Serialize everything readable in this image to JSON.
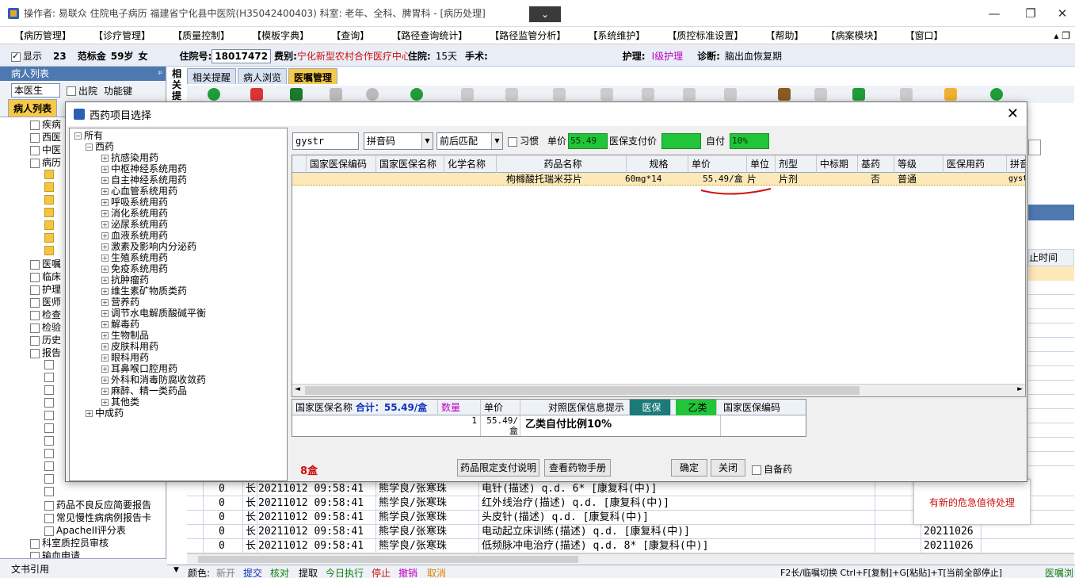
{
  "window": {
    "title": "操作者: 易联众 住院电子病历 福建省宁化县中医院(H35042400403) 科室: 老年、全科、脾胃科 - [病历处理]",
    "dropdown_glyph": "⌄",
    "min_glyph": "—",
    "restore_glyph": "❐",
    "close_glyph": "✕"
  },
  "menu": {
    "items": [
      "病历管理",
      "诊疗管理",
      "质量控制",
      "模板字典",
      "查询",
      "路径查询统计",
      "路径监管分析",
      "系统维护",
      "质控标准设置",
      "帮助",
      "病案模块",
      "窗口"
    ],
    "right_controls": "▴ ❐"
  },
  "patient_bar": {
    "show_label": "显示",
    "bed": "23",
    "name_label": "范标金",
    "age": "59岁",
    "sex": "女",
    "inpatient_no_label": "住院号:",
    "inpatient_no": "18017472",
    "fee_type_label": "费别:",
    "fee_type": "宁化新型农村合作医疗中心",
    "in_hospital_label": "住院:",
    "in_hospital_days": "15天",
    "surgery_label": "手术:",
    "nursing_label": "护理:",
    "nursing_value": "I级护理",
    "diagnosis_label": "诊断:",
    "diagnosis_value": "脑出血恢复期"
  },
  "left_panel": {
    "header": "病人列表",
    "pin": "ᵖ",
    "doctor_select": "本医生",
    "discharged_label": "出院",
    "function_key_label": "功能键",
    "tab_active": "病人列表",
    "tree": [
      "疾病",
      "西医",
      "中医",
      "病历",
      "",
      "",
      "",
      "",
      "",
      "",
      "",
      "医嘱",
      "临床",
      "护理",
      "医师",
      "检查",
      "检验",
      "历史",
      "报告",
      "",
      "",
      "",
      "",
      "",
      "",
      "",
      "",
      "",
      "",
      "",
      "药品不良反应简要报告",
      "常见慢性病病例报告卡",
      "ApacheII评分表",
      "科室质控员审核",
      "输血申请"
    ],
    "bottom": "文书引用"
  },
  "main": {
    "vtab": "相关提醒",
    "tabs": [
      "相关提醒",
      "病人浏览",
      "医嘱管理"
    ],
    "right_header_fragment": "停止时间",
    "rows": [
      {
        "c0": "0",
        "c1": "长",
        "time": "20211012 09:58:41",
        "doctor": "熊学良/张寒珠",
        "order": "电针(描述)  q.d. 6* [康复科(中)]",
        "end": ""
      },
      {
        "c0": "0",
        "c1": "长",
        "time": "20211012 09:58:41",
        "doctor": "熊学良/张寒珠",
        "order": "红外线治疗(描述)  q.d.  [康复科(中)]",
        "end": ""
      },
      {
        "c0": "0",
        "c1": "长",
        "time": "20211012 09:58:41",
        "doctor": "熊学良/张寒珠",
        "order": "头皮针(描述)  q.d.  [康复科(中)]",
        "end": ""
      },
      {
        "c0": "0",
        "c1": "长",
        "time": "20211012 09:58:41",
        "doctor": "熊学良/张寒珠",
        "order": "电动起立床训练(描述)  q.d.  [康复科(中)]",
        "end": "20211026"
      },
      {
        "c0": "0",
        "c1": "长",
        "time": "20211012 09:58:41",
        "doctor": "熊学良/张寒珠",
        "order": "低频脉冲电治疗(描述)  q.d. 8* [康复科(中)]",
        "end": "20211026"
      }
    ],
    "statusbar": {
      "legend_label": "颜色:",
      "new": "新开",
      "submit": "提交",
      "check": "核对",
      "pickup": "提取",
      "today_exec": "今日执行",
      "stop": "停止",
      "revoke": "撤销",
      "cancel": "取消",
      "shortcuts": "F2长/临嘱切换 Ctrl+F[复制]+G[粘贴]+T[当前全部停止]",
      "right": "医嘱浏"
    },
    "colors": {
      "new": "#808080",
      "submit": "#1030c0",
      "check": "#108010",
      "pickup": "#000000",
      "today_exec": "#108010",
      "stop": "#d01010",
      "revoke": "#c000c0",
      "cancel": "#e08000"
    },
    "alert": "有新的危急值待处理"
  },
  "dialog": {
    "title": "西药项目选择",
    "close": "✕",
    "tree": {
      "root": "所有",
      "western": "西药",
      "children": [
        "抗感染用药",
        "中枢神经系统用药",
        "自主神经系统用药",
        "心血管系统用药",
        "呼吸系统用药",
        "消化系统用药",
        "泌尿系统用药",
        "血液系统用药",
        "激素及影响内分泌药",
        "生殖系统用药",
        "免疫系统用药",
        "抗肿瘤药",
        "维生素矿物质类药",
        "营养药",
        "调节水电解质酸碱平衡",
        "解毒药",
        "生物制品",
        "皮肤科用药",
        "眼科用药",
        "耳鼻喉口腔用药",
        "外科和消毒防腐收敛药",
        "麻醉、精一类药品",
        "其他类"
      ],
      "patent": "中成药"
    },
    "filter": {
      "search_value": "gystr",
      "mode": "拼音码",
      "match": "前后匹配",
      "habit_label": "习惯",
      "unit_price_label": "单价",
      "unit_price": "55.49",
      "insurance_label": "医保支付价",
      "insurance_value": "",
      "self_pay_label": "自付",
      "self_pay": "10%"
    },
    "grid_headers": [
      "国家医保编码",
      "国家医保名称",
      "化学名称",
      "药品名称",
      "规格",
      "单价",
      "单位",
      "剂型",
      "中标期",
      "基药",
      "等级",
      "医保用药",
      "拼音"
    ],
    "grid_row": {
      "code": "",
      "name": "",
      "chem": "",
      "drug": "枸橼酸托瑞米芬片",
      "spec": "60mg*14",
      "price": "55.49/盒",
      "unit": "片",
      "form": "片剂",
      "bid": "",
      "base": "否",
      "grade": "普通",
      "ins": "",
      "py": "gyst"
    },
    "summary": {
      "name_label": "国家医保名称",
      "total": "合计：55.49/盒",
      "qty_label": "数量",
      "price_label": "单价",
      "tip_label": "对照医保信息提示",
      "ins_badge": "医保",
      "class_badge": "乙类",
      "code_label": "国家医保编码",
      "qty": "1",
      "price": "55.49/盒",
      "tip": "乙类自付比例10%"
    },
    "bottom": {
      "count": "8盒",
      "limit_btn": "药品限定支付说明",
      "manual_btn": "查看药物手册",
      "ok_btn": "确定",
      "close_btn": "关闭",
      "self_label": "自备药"
    }
  }
}
